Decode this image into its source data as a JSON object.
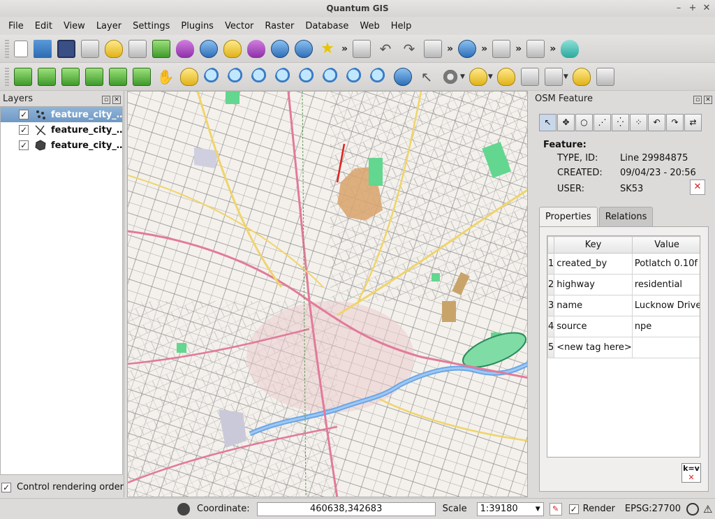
{
  "window": {
    "title": "Quantum GIS",
    "controls": [
      "–",
      "+",
      "✕"
    ]
  },
  "menu": [
    "File",
    "Edit",
    "View",
    "Layer",
    "Settings",
    "Plugins",
    "Vector",
    "Raster",
    "Database",
    "Web",
    "Help"
  ],
  "layers_panel": {
    "title": "Layers",
    "layers": [
      {
        "name": "feature_city_…",
        "checked": true,
        "selected": true,
        "icon": "points-icon"
      },
      {
        "name": "feature_city_…",
        "checked": true,
        "selected": false,
        "icon": "lines-icon"
      },
      {
        "name": "feature_city_…",
        "checked": true,
        "selected": false,
        "icon": "polygon-icon"
      }
    ],
    "control_rendering_order": "Control rendering order"
  },
  "osm_panel": {
    "title": "OSM Feature",
    "feature_label": "Feature:",
    "fields": [
      {
        "label": "TYPE, ID:",
        "value": "Line  29984875"
      },
      {
        "label": "CREATED:",
        "value": "09/04/23 - 20:56"
      },
      {
        "label": "USER:",
        "value": "SK53"
      }
    ],
    "tabs": [
      "Properties",
      "Relations"
    ],
    "table": {
      "headers": [
        "Key",
        "Value"
      ],
      "rows": [
        {
          "n": "1",
          "key": "created_by",
          "value": "Potlatch 0.10f"
        },
        {
          "n": "2",
          "key": "highway",
          "value": "residential"
        },
        {
          "n": "3",
          "key": "name",
          "value": "Lucknow Drive"
        },
        {
          "n": "4",
          "key": "source",
          "value": "npe"
        },
        {
          "n": "5",
          "key": "<new tag here>",
          "value": ""
        }
      ]
    },
    "remove_tag_label": "k=v"
  },
  "status": {
    "coordinate_label": "Coordinate:",
    "coordinate": "460638,342683",
    "scale_label": "Scale",
    "scale": "1:39180",
    "render_label": "Render",
    "epsg": "EPSG:27700"
  }
}
